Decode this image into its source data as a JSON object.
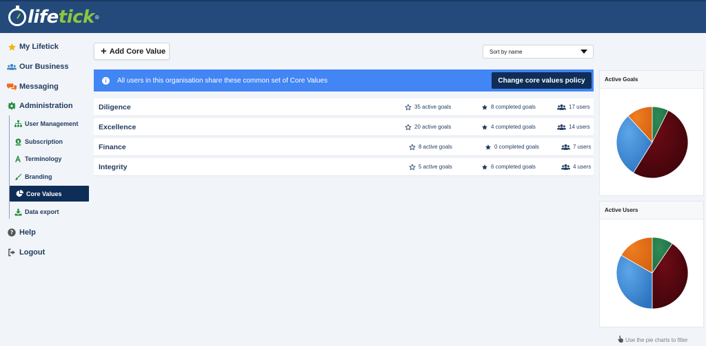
{
  "app": {
    "brand_prefix": "life",
    "brand_accent": "tick",
    "brand_mark": "®"
  },
  "sidebar": {
    "items": [
      {
        "label": "My Lifetick",
        "icon": "star-icon"
      },
      {
        "label": "Our Business",
        "icon": "users-icon"
      },
      {
        "label": "Messaging",
        "icon": "chat-icon"
      },
      {
        "label": "Administration",
        "icon": "gear-icon"
      },
      {
        "label": "Help",
        "icon": "question-icon"
      },
      {
        "label": "Logout",
        "icon": "logout-icon"
      }
    ],
    "sub_items": [
      {
        "label": "User Management",
        "icon": "org-chart-icon"
      },
      {
        "label": "Subscription",
        "icon": "money-icon"
      },
      {
        "label": "Terminology",
        "icon": "font-icon"
      },
      {
        "label": "Branding",
        "icon": "brush-icon"
      },
      {
        "label": "Core Values",
        "icon": "pie-icon",
        "active": true
      },
      {
        "label": "Data export",
        "icon": "download-icon"
      }
    ]
  },
  "toolbar": {
    "add_label": "Add Core Value",
    "sort_value": "Sort by name"
  },
  "banner": {
    "text": "All users in this organisation share these common set of Core Values",
    "button_label": "Change core values policy"
  },
  "core_values": [
    {
      "name": "Diligence",
      "active": "35 active goals",
      "completed": "8 completed goals",
      "users": "17 users"
    },
    {
      "name": "Excellence",
      "active": "20 active goals",
      "completed": "4 completed goals",
      "users": "14 users"
    },
    {
      "name": "Finance",
      "active": "8 active goals",
      "completed": "0 completed goals",
      "users": "7 users"
    },
    {
      "name": "Integrity",
      "active": "5 active goals",
      "completed": "6 completed goals",
      "users": "4 users"
    }
  ],
  "panels": {
    "active_goals_title": "Active Goals",
    "active_users_title": "Active Users",
    "hint": "Use the pie charts to filter"
  },
  "colors": {
    "header": "#234a7a",
    "banner": "#4285f4",
    "accent_dark": "#0f2e57",
    "brand_green": "#8cc63f",
    "pie_green": "#2e8b57",
    "pie_red": "#6e0b16",
    "pie_blue": "#5ea6e8",
    "pie_orange": "#ef7d22"
  },
  "chart_data": [
    {
      "type": "pie",
      "title": "Active Goals",
      "categories": [
        "Diligence",
        "Excellence",
        "Finance",
        "Integrity"
      ],
      "values": [
        35,
        20,
        8,
        5
      ]
    },
    {
      "type": "pie",
      "title": "Active Users",
      "categories": [
        "Diligence",
        "Excellence",
        "Finance",
        "Integrity"
      ],
      "values": [
        17,
        14,
        7,
        4
      ]
    }
  ]
}
